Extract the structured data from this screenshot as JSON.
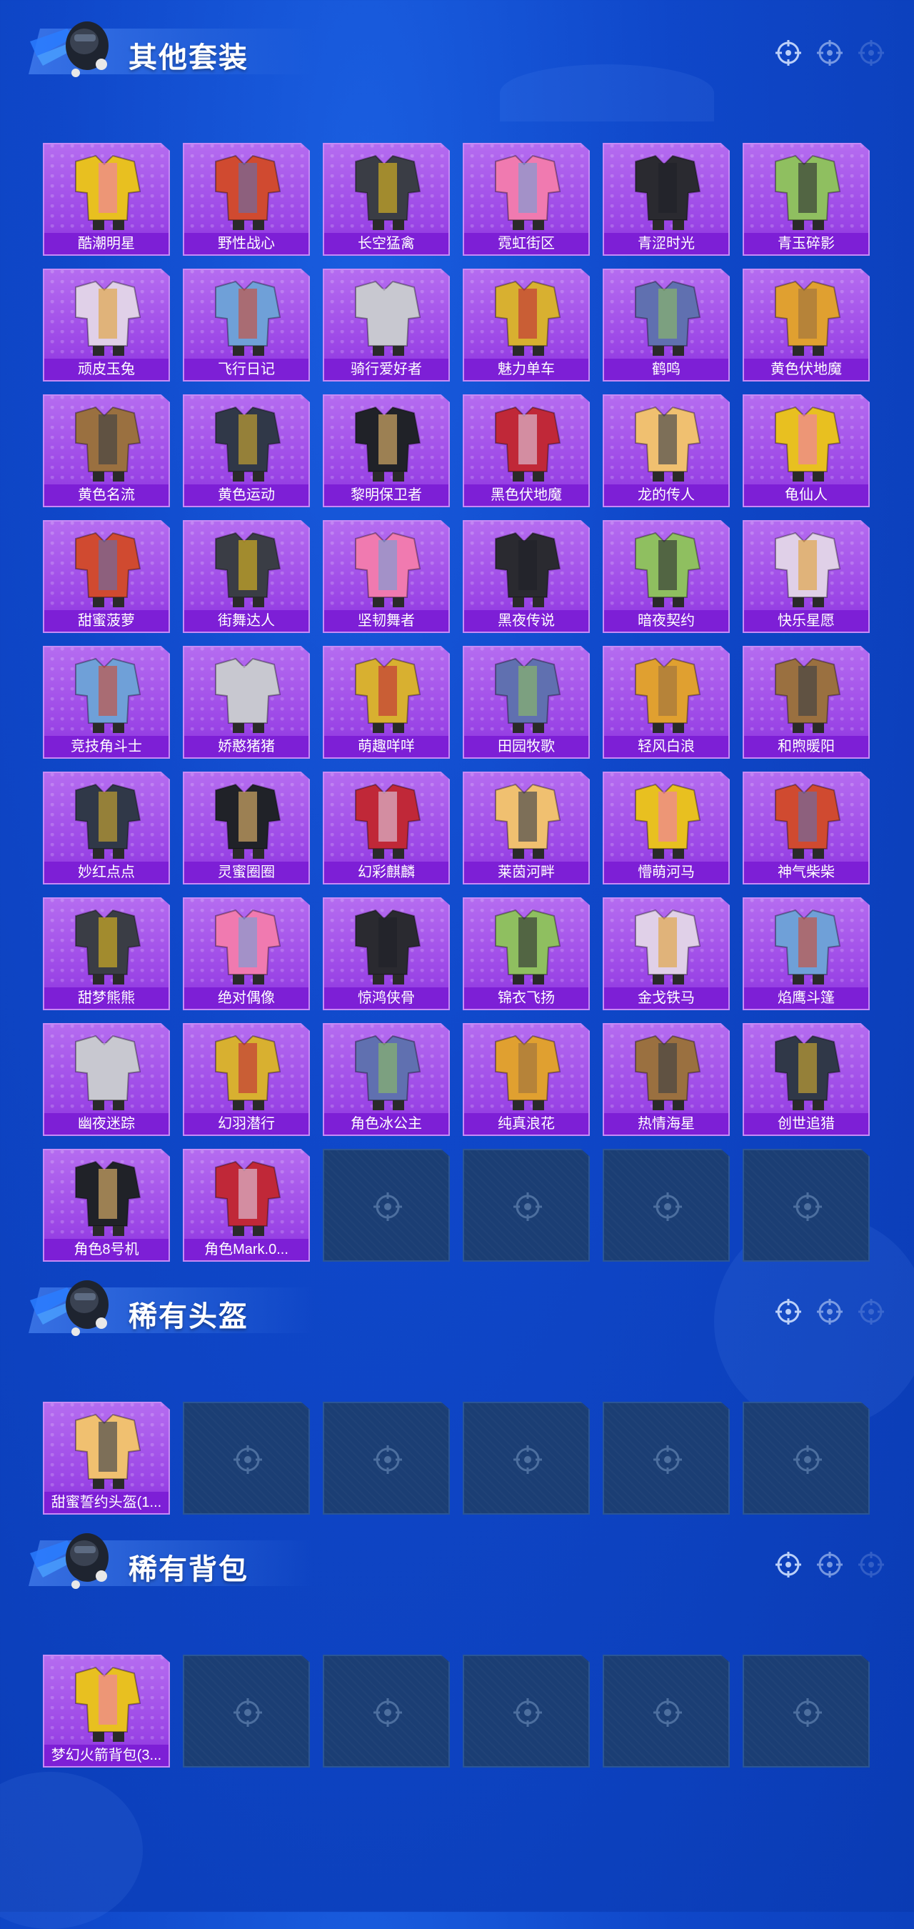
{
  "sections": [
    {
      "title": "其他套装",
      "items": [
        "酷潮明星",
        "野性战心",
        "长空猛禽",
        "霓虹街区",
        "青涩时光",
        "青玉碎影",
        "顽皮玉兔",
        "飞行日记",
        "骑行爱好者",
        "魅力单车",
        "鹤鸣",
        "黄色伏地魔",
        "黄色名流",
        "黄色运动",
        "黎明保卫者",
        "黑色伏地魔",
        "龙的传人",
        "龟仙人",
        "甜蜜菠萝",
        "街舞达人",
        "坚韧舞者",
        "黑夜传说",
        "暗夜契约",
        "快乐星愿",
        "竞技角斗士",
        "娇憨猪猪",
        "萌趣咩咩",
        "田园牧歌",
        "轻风白浪",
        "和煦暖阳",
        "妙红点点",
        "灵蜜圈圈",
        "幻彩麒麟",
        "莱茵河畔",
        "懵萌河马",
        "神气柴柴",
        "甜梦熊熊",
        "绝对偶像",
        "惊鸿侠骨",
        "锦衣飞扬",
        "金戈铁马",
        "焰鹰斗篷",
        "幽夜迷踪",
        "幻羽潜行",
        "角色冰公主",
        "纯真浪花",
        "热情海星",
        "创世追猎",
        "角色8号机",
        "角色Mark.0..."
      ]
    },
    {
      "title": "稀有头盔",
      "items": [
        "甜蜜誓约头盔(1..."
      ]
    },
    {
      "title": "稀有背包",
      "items": [
        "梦幻火箭背包(3..."
      ]
    }
  ],
  "colors": {
    "background": "#0f47c9",
    "card_purple": "#9b46e6",
    "label_purple": "#7d1fd6",
    "empty_slot": "#1b3e74"
  },
  "icons": {
    "section_emblem": "character-emblem-icon",
    "section_deco": "crosshair-icon",
    "empty_slot": "crosshair-icon"
  }
}
